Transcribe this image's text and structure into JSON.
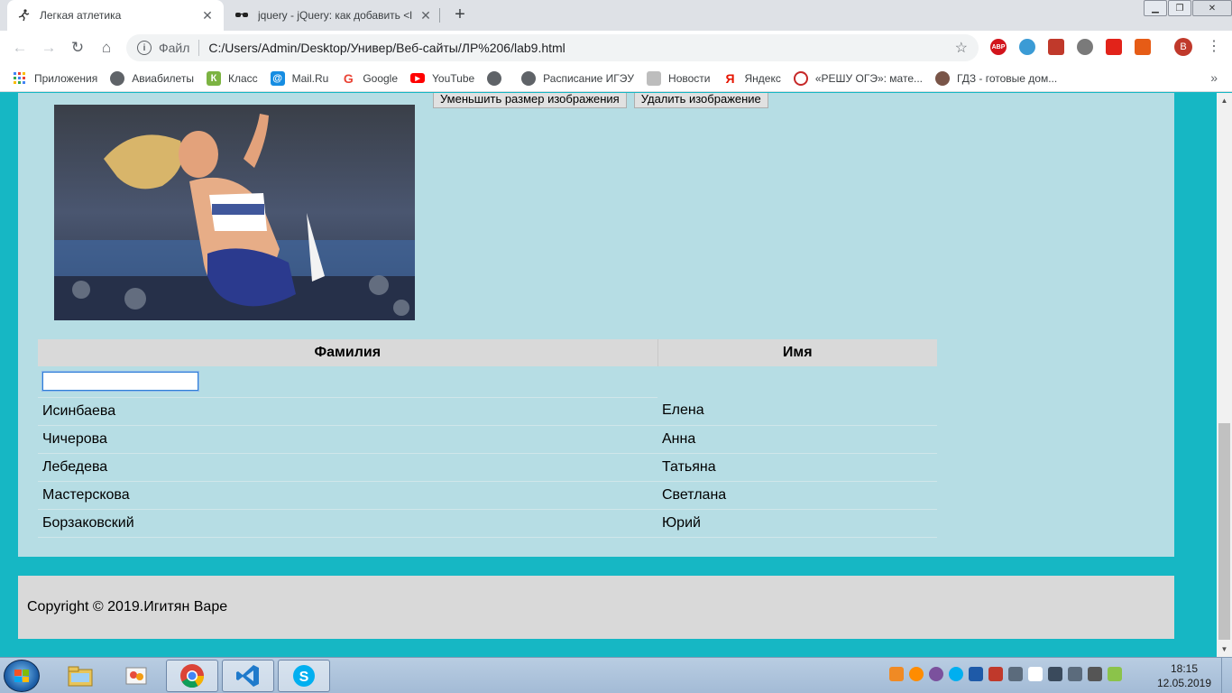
{
  "tabs": [
    {
      "title": "Легкая атлетика",
      "active": true,
      "icon": "runner-icon"
    },
    {
      "title": "jquery - jQuery: как добавить <l",
      "active": false,
      "icon": "sunglasses-icon"
    }
  ],
  "toolbar": {
    "scheme_label": "Файл",
    "url": "C:/Users/Admin/Desktop/Универ/Веб-сайты/ЛР%206/lab9.html",
    "avatar_letter": "В"
  },
  "extensions": [
    {
      "name": "adblock-icon",
      "label": "ABP",
      "color": "#d2141c"
    },
    {
      "name": "speed-dial-icon",
      "label": "",
      "color": "#3b9bd5"
    },
    {
      "name": "pdf-icon",
      "label": "",
      "color": "#c0392b"
    },
    {
      "name": "shield-icon",
      "label": "",
      "color": "#7a7a7a"
    },
    {
      "name": "flag-icon",
      "label": "",
      "color": "#e2231a"
    },
    {
      "name": "office-icon",
      "label": "",
      "color": "#e65c16"
    }
  ],
  "bookmarks": [
    {
      "label": "Приложения",
      "icon": "apps-grid-icon",
      "color": "#4285f4"
    },
    {
      "label": "Авиабилеты",
      "icon": "globe-icon",
      "color": "#5f6368"
    },
    {
      "label": "Класс",
      "icon": "class-icon",
      "color": "#7cb342"
    },
    {
      "label": "Mail.Ru",
      "icon": "mailru-icon",
      "color": "#168de2"
    },
    {
      "label": "Google",
      "icon": "google-icon",
      "color": "#ea4335"
    },
    {
      "label": "YouTube",
      "icon": "youtube-icon",
      "color": "#ff0000"
    },
    {
      "label": "",
      "icon": "globe-icon",
      "color": "#5f6368"
    },
    {
      "label": "Расписание ИГЭУ",
      "icon": "globe-icon",
      "color": "#5f6368"
    },
    {
      "label": "Новости",
      "icon": "news-icon",
      "color": "#9e9e9e"
    },
    {
      "label": "Яндекс",
      "icon": "yandex-icon",
      "color": "#e61400"
    },
    {
      "label": "«РЕШУ ОГЭ»: мате...",
      "icon": "reshu-icon",
      "color": "#c62828"
    },
    {
      "label": "ГДЗ - готовые дом...",
      "icon": "owl-icon",
      "color": "#795548"
    }
  ],
  "page": {
    "buttons": {
      "shrink_image": "Уменьшить размер изображения",
      "delete_image": "Удалить изображение"
    },
    "table": {
      "headers": [
        "Фамилия",
        "Имя"
      ],
      "filter_value": "",
      "rows": [
        [
          "Исинбаева",
          "Елена"
        ],
        [
          "Чичерова",
          "Анна"
        ],
        [
          "Лебедева",
          "Татьяна"
        ],
        [
          "Мастерскова",
          "Светлана"
        ],
        [
          "Борзаковский",
          "Юрий"
        ]
      ]
    },
    "footer": "Copyright © 2019.Игитян Варе"
  },
  "taskbar": {
    "apps": [
      "explorer-icon",
      "paint-icon",
      "chrome-icon",
      "vscode-icon",
      "skype-icon"
    ],
    "active_app": "chrome-icon",
    "time": "18:15",
    "date": "12.05.2019"
  },
  "colors": {
    "page_background": "#16b7c4",
    "content_background": "#b6dde4",
    "table_header": "#d9d9d9",
    "footer_background": "#d9d9d9"
  }
}
